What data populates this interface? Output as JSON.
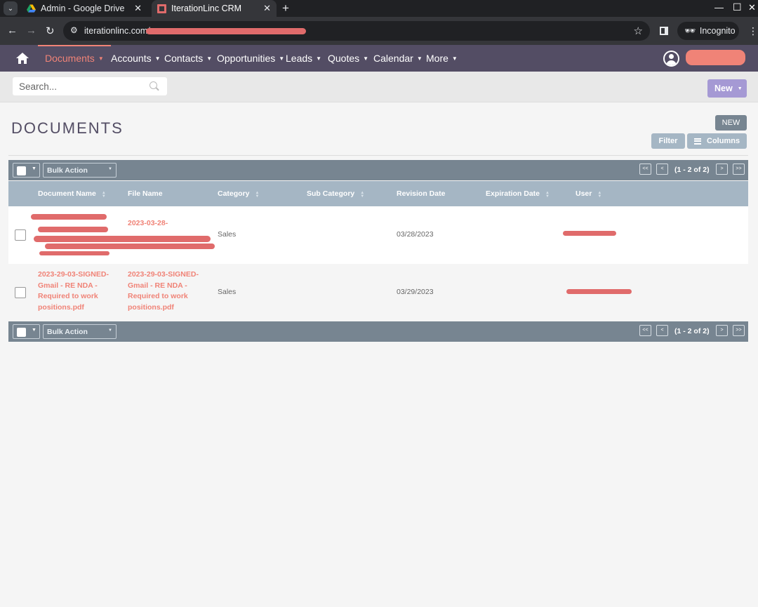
{
  "browser": {
    "tabs": [
      {
        "title": "Admin - Google Drive",
        "active": false
      },
      {
        "title": "IterationLinc CRM",
        "active": true
      }
    ],
    "url_visible": "iterationlinc.com/",
    "incognito_label": "Incognito"
  },
  "nav": {
    "items": [
      {
        "label": "Documents",
        "active": true
      },
      {
        "label": "Accounts"
      },
      {
        "label": "Contacts"
      },
      {
        "label": "Opportunities"
      },
      {
        "label": "Leads"
      },
      {
        "label": "Quotes"
      },
      {
        "label": "Calendar"
      },
      {
        "label": "More"
      }
    ]
  },
  "search": {
    "placeholder": "Search..."
  },
  "new_button": "New",
  "page": {
    "title": "DOCUMENTS",
    "new_label": "NEW",
    "filter_label": "Filter",
    "columns_label": "Columns"
  },
  "list": {
    "bulk_action": "Bulk Action",
    "pagination": {
      "first": "<<",
      "prev": "<",
      "count": "(1 - 2 of 2)",
      "next": ">",
      "last": ">>"
    },
    "columns": [
      "Document Name",
      "File Name",
      "Category",
      "Sub Category",
      "Revision Date",
      "Expiration Date",
      "User"
    ],
    "rows": [
      {
        "document_name": "",
        "file_name": "2023-03-28-",
        "category": "Sales",
        "sub_category": "",
        "revision_date": "03/28/2023",
        "expiration_date": "",
        "user": ""
      },
      {
        "document_name": "2023-29-03-SIGNED-Gmail - RE NDA - Required to work positions.pdf",
        "file_name": "2023-29-03-SIGNED-Gmail - RE NDA - Required to work positions.pdf",
        "category": "Sales",
        "sub_category": "",
        "revision_date": "03/29/2023",
        "expiration_date": "",
        "user": ""
      }
    ]
  },
  "colors": {
    "nav_bg": "#534d64",
    "accent": "#f08377",
    "new_btn": "#a599d4",
    "list_header": "#778591",
    "col_header": "#a5b6c4"
  }
}
